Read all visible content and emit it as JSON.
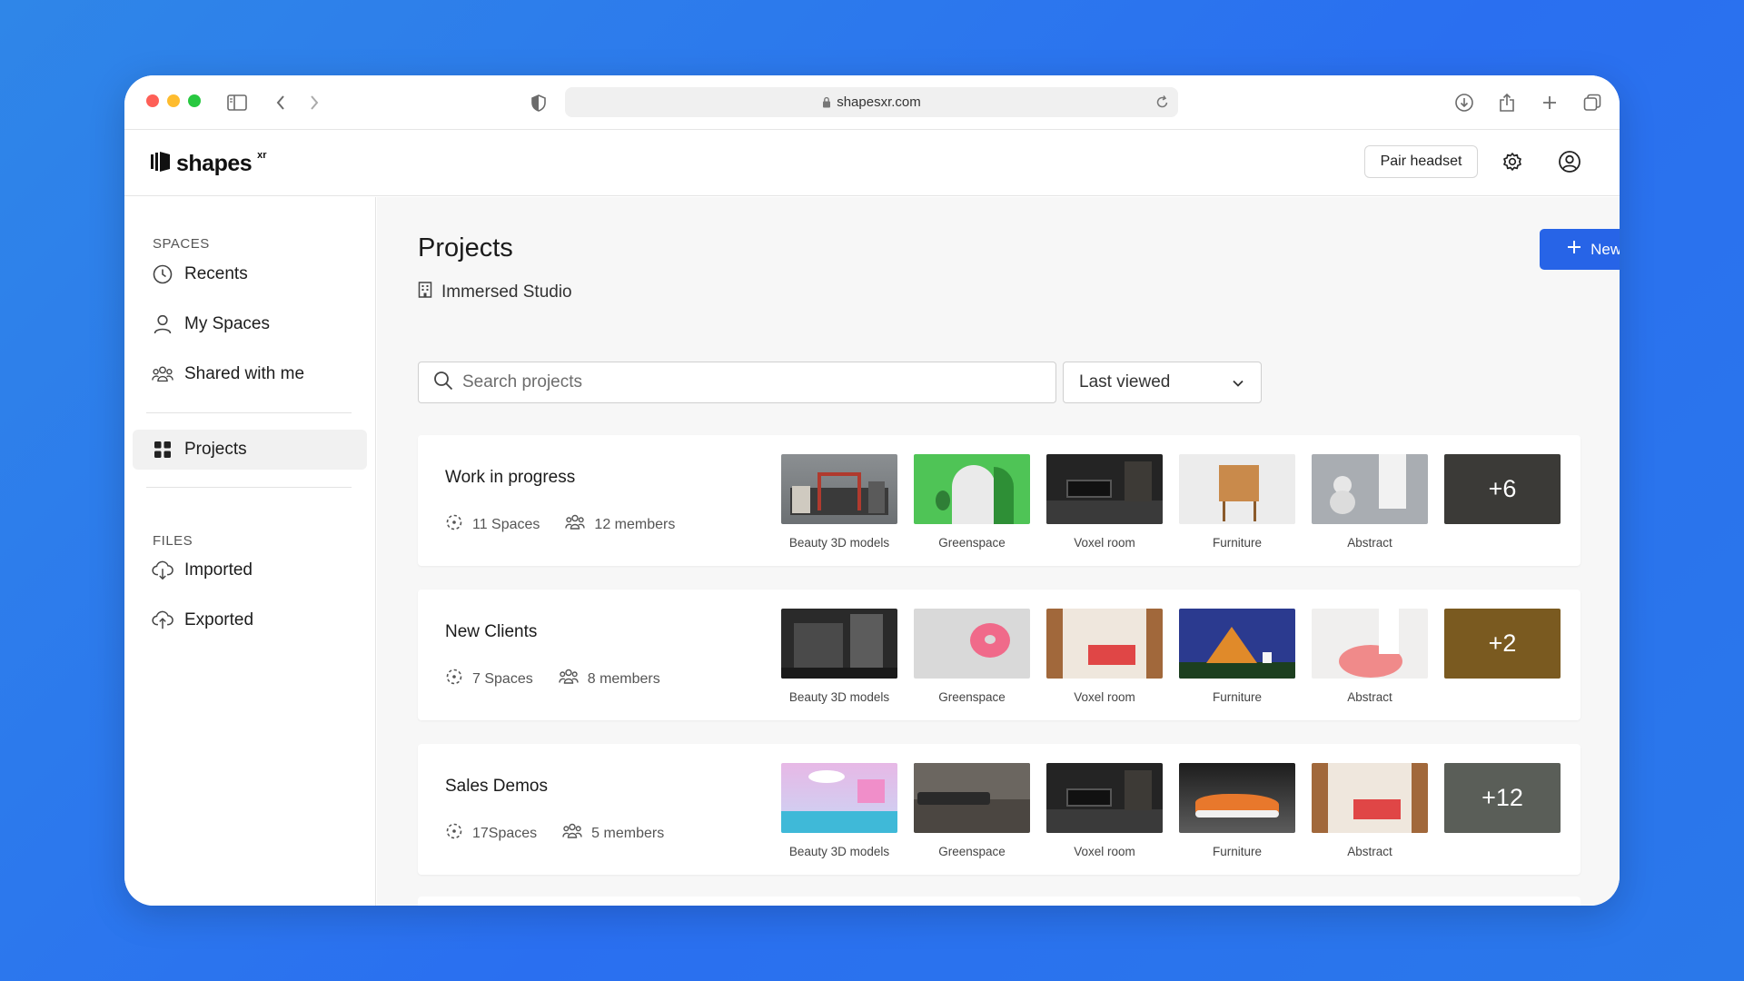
{
  "browser": {
    "url": "shapesxr.com"
  },
  "app": {
    "logo_text": "shapes",
    "logo_sup": "xr",
    "pair_headset_label": "Pair headset"
  },
  "sidebar": {
    "spaces_label": "SPACES",
    "files_label": "FILES",
    "items": [
      {
        "label": "Recents",
        "icon": "clock-icon"
      },
      {
        "label": "My Spaces",
        "icon": "user-icon"
      },
      {
        "label": "Shared with me",
        "icon": "group-icon"
      },
      {
        "label": "Projects",
        "icon": "grid-icon",
        "active": true
      },
      {
        "label": "Imported",
        "icon": "cloud-download-icon"
      },
      {
        "label": "Exported",
        "icon": "cloud-upload-icon"
      }
    ]
  },
  "main": {
    "title": "Projects",
    "workspace": "Immersed Studio",
    "new_project_label": "New project",
    "search_placeholder": "Search projects",
    "sort_value": "Last viewed"
  },
  "projects": [
    {
      "name": "Work in progress",
      "spaces": "11 Spaces",
      "members": "12 members",
      "thumbs": [
        "Beauty 3D models",
        "Greenspace",
        "Voxel room",
        "Furniture",
        "Abstract"
      ],
      "more": "+6"
    },
    {
      "name": "New Clients",
      "spaces": "7 Spaces",
      "members": "8 members",
      "thumbs": [
        "Beauty 3D models",
        "Greenspace",
        "Voxel room",
        "Furniture",
        "Abstract"
      ],
      "more": "+2"
    },
    {
      "name": "Sales Demos",
      "spaces": "17Spaces",
      "members": "5 members",
      "thumbs": [
        "Beauty 3D models",
        "Greenspace",
        "Voxel room",
        "Furniture",
        "Abstract"
      ],
      "more": "+12"
    }
  ],
  "colors": {
    "accent": "#2764e7",
    "background_gradient": "#2a6ff0"
  }
}
